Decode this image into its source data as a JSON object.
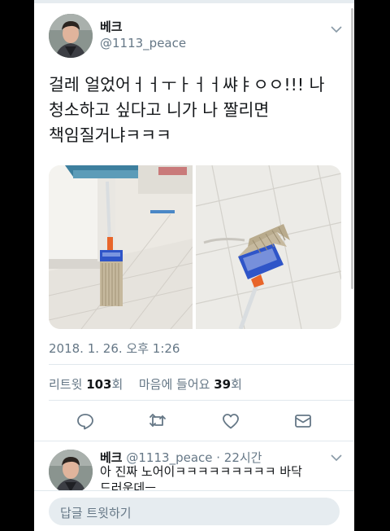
{
  "tweet": {
    "author_name": "베크",
    "handle": "@1113_peace",
    "text_lines": [
      "걸레 얼었어ㅓㅓㅜㅏㅓㅓ쌰ㅑㅇㅇ!!! 나",
      "청소하고 싶다고 니가 나 짤리면",
      "책임질거냐ㅋㅋㅋ"
    ],
    "timestamp": "2018. 1. 26. 오후 1:26"
  },
  "stats": {
    "retweets_label": "리트윗",
    "retweets_count": "103",
    "retweets_unit": "회",
    "likes_label": "마음에 들어요",
    "likes_count": "39",
    "likes_unit": "회"
  },
  "actions": {
    "icons": [
      "reply-icon",
      "retweet-icon",
      "like-icon",
      "direct-message-icon"
    ]
  },
  "reply": {
    "author_name": "베크",
    "meta": "@1113_peace · 22시간",
    "text_lines": [
      "아 진짜 노어이ㅋㅋㅋㅋㅋㅋㅋㅋㅋ 바닥",
      "드러운데ㅡ"
    ]
  },
  "compose": {
    "placeholder": "답글 트윗하기"
  },
  "colors": {
    "text_primary": "#14171a",
    "text_secondary": "#657786",
    "divider": "#e1e8ed",
    "icon": "#657786",
    "compose_bg": "#e6ecf0",
    "mop_head_blue": "#2f55c8",
    "mop_joint_orange": "#e8652a"
  }
}
